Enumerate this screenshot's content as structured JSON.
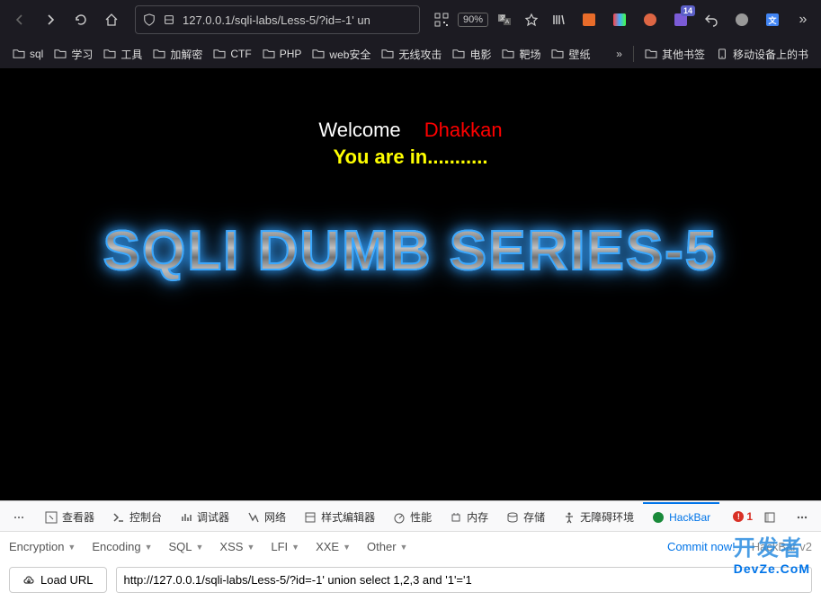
{
  "browser": {
    "url_display": "127.0.0.1/sqli-labs/Less-5/?id=-1' un",
    "zoom": "90%",
    "badge_count": "14"
  },
  "bookmarks": [
    {
      "label": "sql"
    },
    {
      "label": "学习"
    },
    {
      "label": "工具"
    },
    {
      "label": "加解密"
    },
    {
      "label": "CTF"
    },
    {
      "label": "PHP"
    },
    {
      "label": "web安全"
    },
    {
      "label": "无线攻击"
    },
    {
      "label": "电影"
    },
    {
      "label": "靶场"
    },
    {
      "label": "壁纸"
    }
  ],
  "bookmarks_right": [
    {
      "label": "其他书签"
    },
    {
      "label": "移动设备上的书"
    }
  ],
  "page": {
    "welcome": "Welcome",
    "dhakkan": "Dhakkan",
    "you_are_in": "You are in...........",
    "banner": "SQLI DUMB SERIES-5"
  },
  "devtools": {
    "tabs": [
      {
        "label": "查看器",
        "icon": "inspector"
      },
      {
        "label": "控制台",
        "icon": "console"
      },
      {
        "label": "调试器",
        "icon": "debugger"
      },
      {
        "label": "网络",
        "icon": "network"
      },
      {
        "label": "样式编辑器",
        "icon": "style"
      },
      {
        "label": "性能",
        "icon": "perf"
      },
      {
        "label": "内存",
        "icon": "memory"
      },
      {
        "label": "存储",
        "icon": "storage"
      },
      {
        "label": "无障碍环境",
        "icon": "a11y"
      },
      {
        "label": "HackBar",
        "icon": "hackbar",
        "active": true
      }
    ],
    "error_count": "1"
  },
  "hackbar": {
    "menu": [
      "Encryption",
      "Encoding",
      "SQL",
      "XSS",
      "LFI",
      "XXE",
      "Other"
    ],
    "commit": "Commit now!",
    "version": "HackBar v2",
    "load_url_label": "Load URL",
    "input_value": "http://127.0.0.1/sqli-labs/Less-5/?id=-1' union select 1,2,3 and '1'='1"
  },
  "watermark": {
    "cn": "开发者",
    "en": "DevZe.CoM"
  }
}
